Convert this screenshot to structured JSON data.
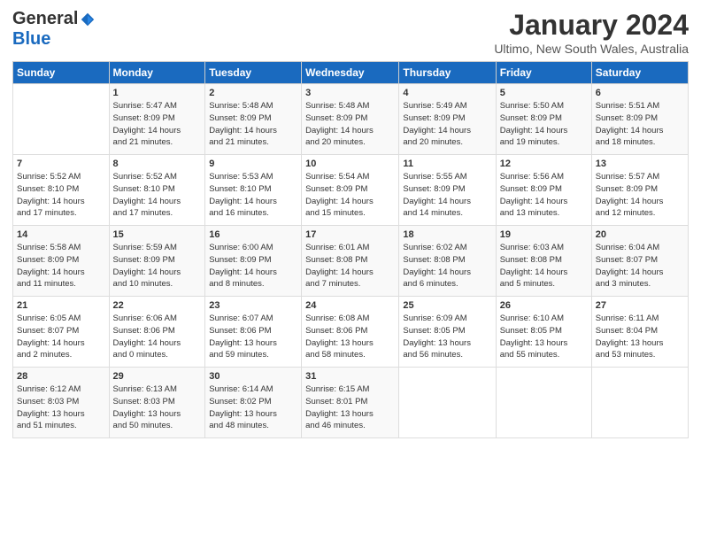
{
  "logo": {
    "general": "General",
    "blue": "Blue"
  },
  "title": "January 2024",
  "subtitle": "Ultimo, New South Wales, Australia",
  "days_of_week": [
    "Sunday",
    "Monday",
    "Tuesday",
    "Wednesday",
    "Thursday",
    "Friday",
    "Saturday"
  ],
  "weeks": [
    [
      {
        "day": "",
        "info": ""
      },
      {
        "day": "1",
        "info": "Sunrise: 5:47 AM\nSunset: 8:09 PM\nDaylight: 14 hours\nand 21 minutes."
      },
      {
        "day": "2",
        "info": "Sunrise: 5:48 AM\nSunset: 8:09 PM\nDaylight: 14 hours\nand 21 minutes."
      },
      {
        "day": "3",
        "info": "Sunrise: 5:48 AM\nSunset: 8:09 PM\nDaylight: 14 hours\nand 20 minutes."
      },
      {
        "day": "4",
        "info": "Sunrise: 5:49 AM\nSunset: 8:09 PM\nDaylight: 14 hours\nand 20 minutes."
      },
      {
        "day": "5",
        "info": "Sunrise: 5:50 AM\nSunset: 8:09 PM\nDaylight: 14 hours\nand 19 minutes."
      },
      {
        "day": "6",
        "info": "Sunrise: 5:51 AM\nSunset: 8:09 PM\nDaylight: 14 hours\nand 18 minutes."
      }
    ],
    [
      {
        "day": "7",
        "info": "Sunrise: 5:52 AM\nSunset: 8:10 PM\nDaylight: 14 hours\nand 17 minutes."
      },
      {
        "day": "8",
        "info": "Sunrise: 5:52 AM\nSunset: 8:10 PM\nDaylight: 14 hours\nand 17 minutes."
      },
      {
        "day": "9",
        "info": "Sunrise: 5:53 AM\nSunset: 8:10 PM\nDaylight: 14 hours\nand 16 minutes."
      },
      {
        "day": "10",
        "info": "Sunrise: 5:54 AM\nSunset: 8:09 PM\nDaylight: 14 hours\nand 15 minutes."
      },
      {
        "day": "11",
        "info": "Sunrise: 5:55 AM\nSunset: 8:09 PM\nDaylight: 14 hours\nand 14 minutes."
      },
      {
        "day": "12",
        "info": "Sunrise: 5:56 AM\nSunset: 8:09 PM\nDaylight: 14 hours\nand 13 minutes."
      },
      {
        "day": "13",
        "info": "Sunrise: 5:57 AM\nSunset: 8:09 PM\nDaylight: 14 hours\nand 12 minutes."
      }
    ],
    [
      {
        "day": "14",
        "info": "Sunrise: 5:58 AM\nSunset: 8:09 PM\nDaylight: 14 hours\nand 11 minutes."
      },
      {
        "day": "15",
        "info": "Sunrise: 5:59 AM\nSunset: 8:09 PM\nDaylight: 14 hours\nand 10 minutes."
      },
      {
        "day": "16",
        "info": "Sunrise: 6:00 AM\nSunset: 8:09 PM\nDaylight: 14 hours\nand 8 minutes."
      },
      {
        "day": "17",
        "info": "Sunrise: 6:01 AM\nSunset: 8:08 PM\nDaylight: 14 hours\nand 7 minutes."
      },
      {
        "day": "18",
        "info": "Sunrise: 6:02 AM\nSunset: 8:08 PM\nDaylight: 14 hours\nand 6 minutes."
      },
      {
        "day": "19",
        "info": "Sunrise: 6:03 AM\nSunset: 8:08 PM\nDaylight: 14 hours\nand 5 minutes."
      },
      {
        "day": "20",
        "info": "Sunrise: 6:04 AM\nSunset: 8:07 PM\nDaylight: 14 hours\nand 3 minutes."
      }
    ],
    [
      {
        "day": "21",
        "info": "Sunrise: 6:05 AM\nSunset: 8:07 PM\nDaylight: 14 hours\nand 2 minutes."
      },
      {
        "day": "22",
        "info": "Sunrise: 6:06 AM\nSunset: 8:06 PM\nDaylight: 14 hours\nand 0 minutes."
      },
      {
        "day": "23",
        "info": "Sunrise: 6:07 AM\nSunset: 8:06 PM\nDaylight: 13 hours\nand 59 minutes."
      },
      {
        "day": "24",
        "info": "Sunrise: 6:08 AM\nSunset: 8:06 PM\nDaylight: 13 hours\nand 58 minutes."
      },
      {
        "day": "25",
        "info": "Sunrise: 6:09 AM\nSunset: 8:05 PM\nDaylight: 13 hours\nand 56 minutes."
      },
      {
        "day": "26",
        "info": "Sunrise: 6:10 AM\nSunset: 8:05 PM\nDaylight: 13 hours\nand 55 minutes."
      },
      {
        "day": "27",
        "info": "Sunrise: 6:11 AM\nSunset: 8:04 PM\nDaylight: 13 hours\nand 53 minutes."
      }
    ],
    [
      {
        "day": "28",
        "info": "Sunrise: 6:12 AM\nSunset: 8:03 PM\nDaylight: 13 hours\nand 51 minutes."
      },
      {
        "day": "29",
        "info": "Sunrise: 6:13 AM\nSunset: 8:03 PM\nDaylight: 13 hours\nand 50 minutes."
      },
      {
        "day": "30",
        "info": "Sunrise: 6:14 AM\nSunset: 8:02 PM\nDaylight: 13 hours\nand 48 minutes."
      },
      {
        "day": "31",
        "info": "Sunrise: 6:15 AM\nSunset: 8:01 PM\nDaylight: 13 hours\nand 46 minutes."
      },
      {
        "day": "",
        "info": ""
      },
      {
        "day": "",
        "info": ""
      },
      {
        "day": "",
        "info": ""
      }
    ]
  ]
}
